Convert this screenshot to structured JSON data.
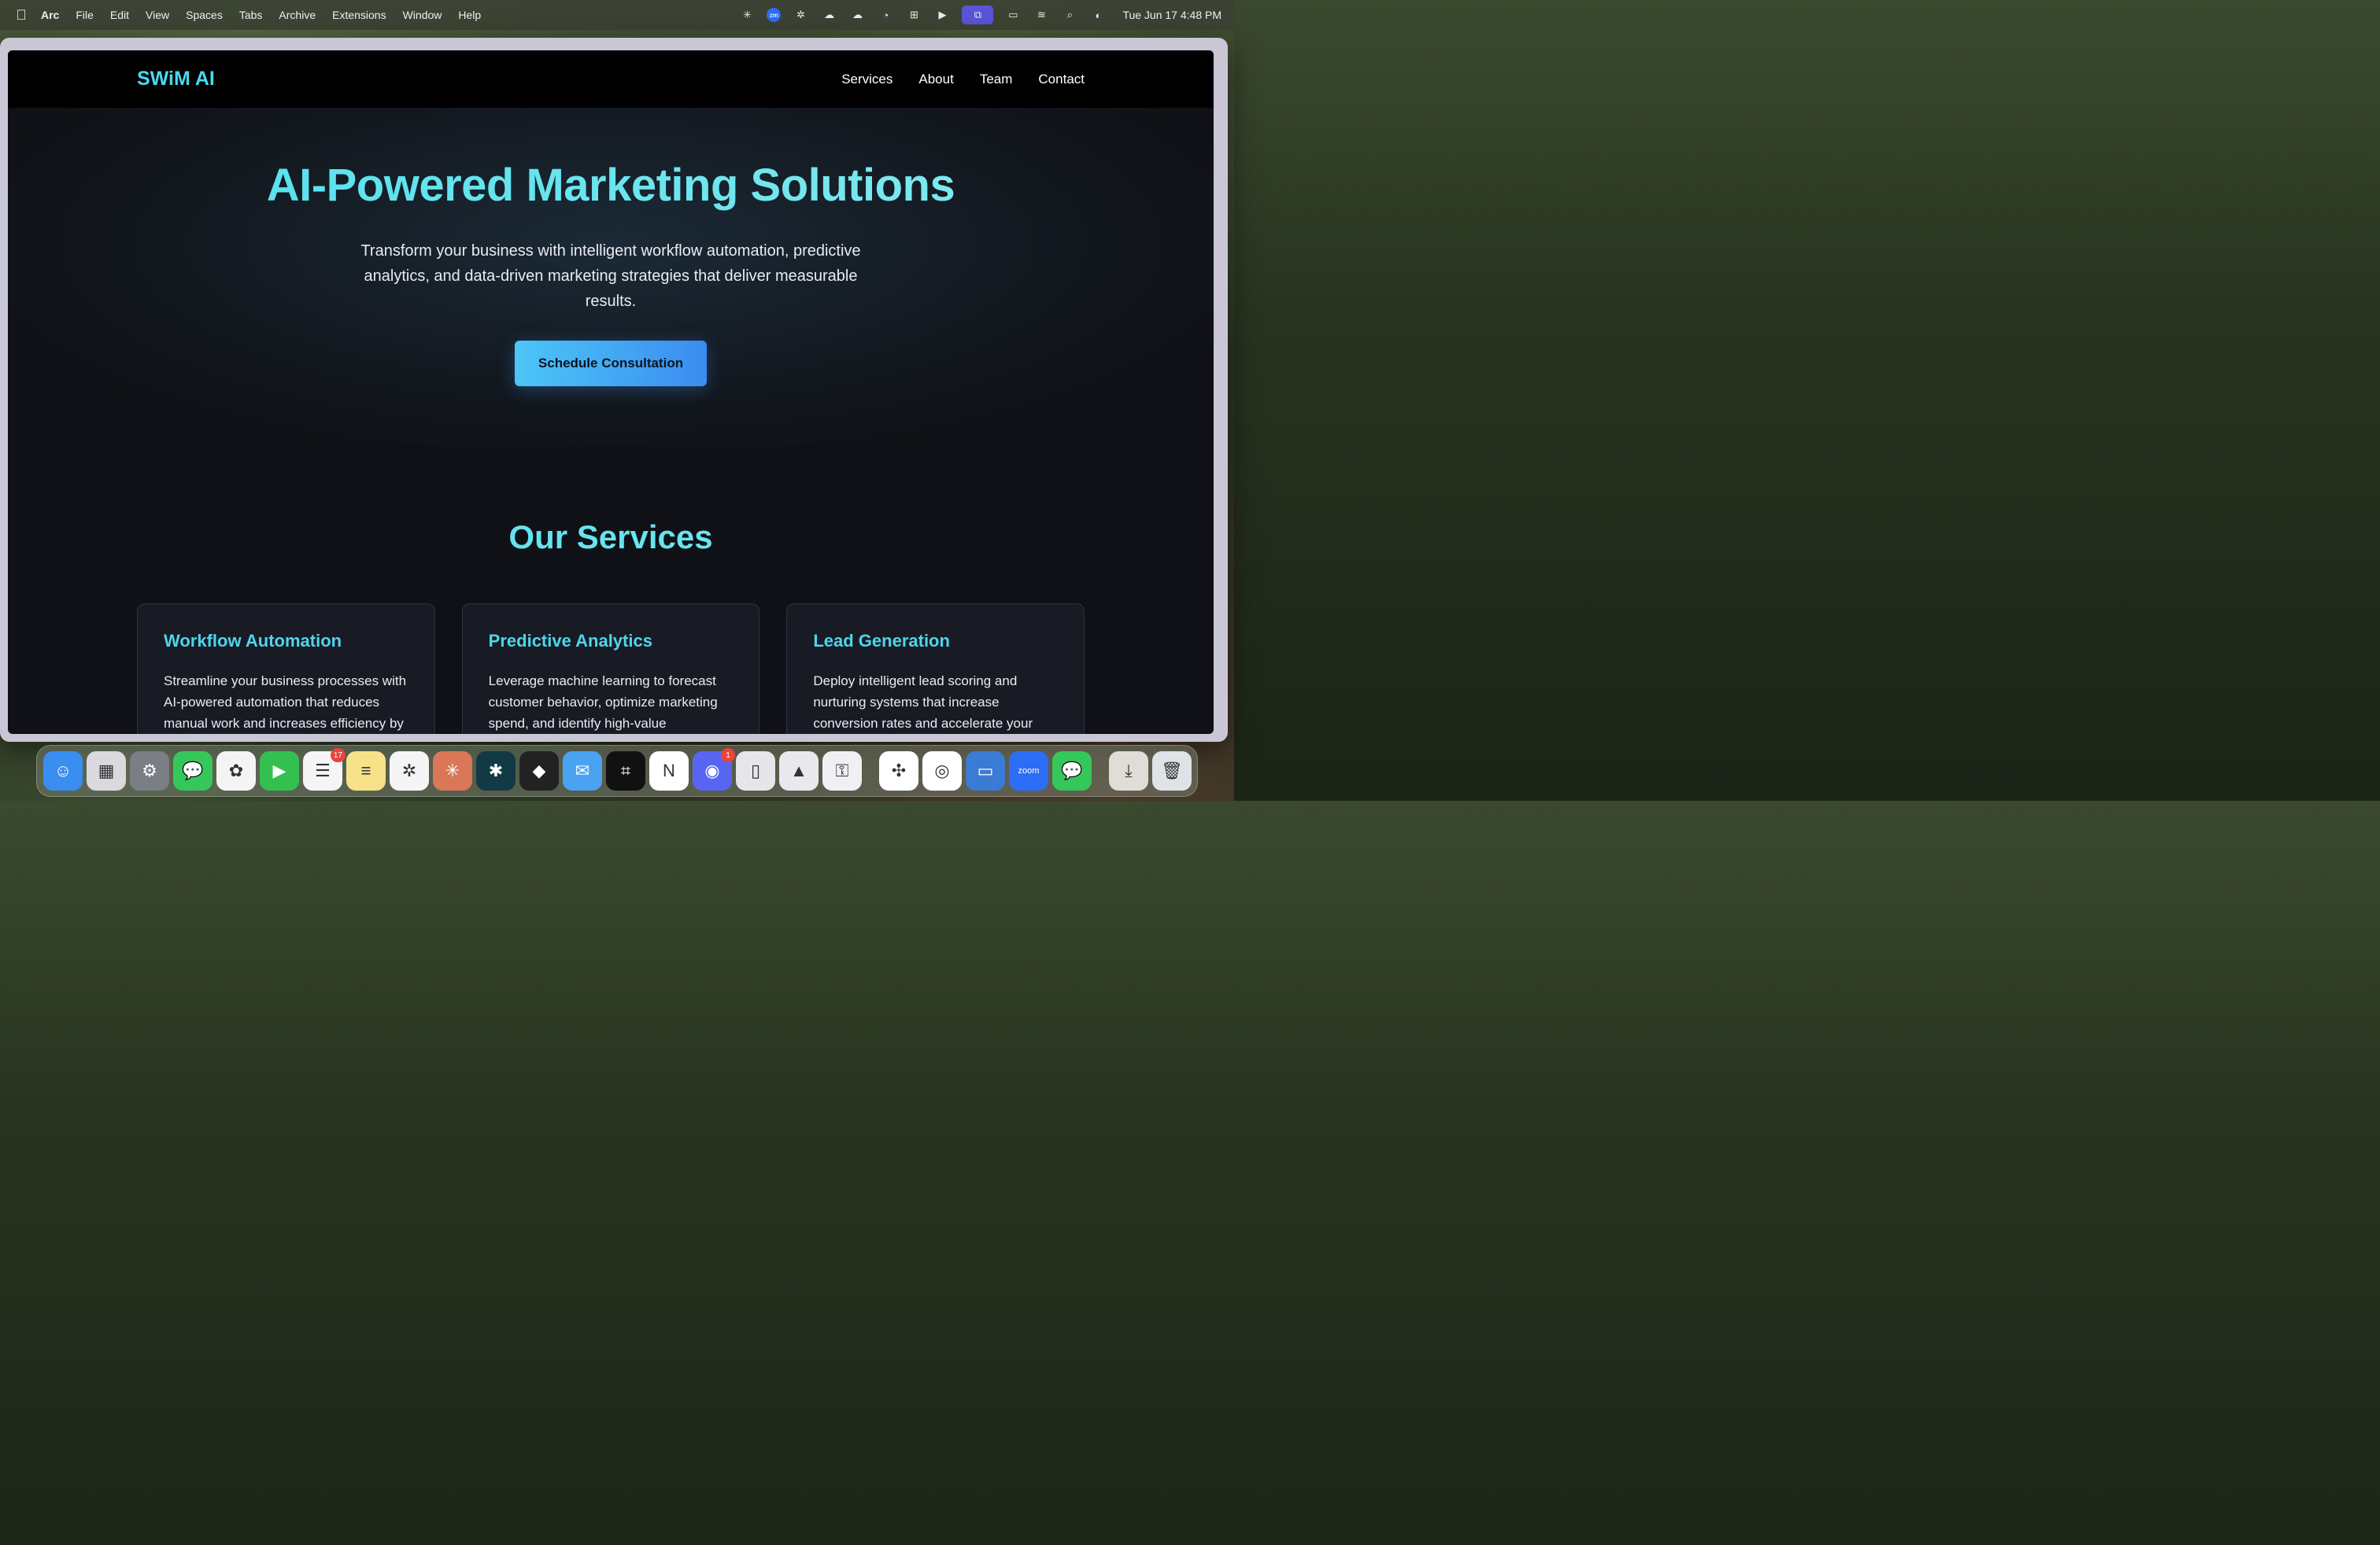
{
  "menubar": {
    "app_name": "Arc",
    "items": [
      "File",
      "Edit",
      "View",
      "Spaces",
      "Tabs",
      "Archive",
      "Extensions",
      "Window",
      "Help"
    ],
    "status_icons": [
      "perplexity-icon",
      "zoom-status-icon",
      "chatgpt-icon",
      "icloud-icon",
      "cloud-sync-icon",
      "activity-icon",
      "grid-icon",
      "play-icon",
      "screen-mirror-icon",
      "battery-icon",
      "wifi-icon",
      "search-icon",
      "control-center-icon"
    ],
    "zoom_label": "zm",
    "clock": "Tue Jun 17  4:48 PM"
  },
  "site": {
    "logo": "SWiM AI",
    "nav": [
      "Services",
      "About",
      "Team",
      "Contact"
    ],
    "hero": {
      "title": "AI-Powered Marketing Solutions",
      "subtitle": "Transform your business with intelligent workflow automation, predictive analytics, and data-driven marketing strategies that deliver measurable results.",
      "cta": "Schedule Consultation"
    },
    "services": {
      "heading": "Our Services",
      "cards": [
        {
          "title": "Workflow Automation",
          "text": "Streamline your business processes with AI-powered automation that reduces manual work and increases efficiency by"
        },
        {
          "title": "Predictive Analytics",
          "text": "Leverage machine learning to forecast customer behavior, optimize marketing spend, and identify high-value"
        },
        {
          "title": "Lead Generation",
          "text": "Deploy intelligent lead scoring and nurturing systems that increase conversion rates and accelerate your"
        }
      ]
    }
  },
  "dock": {
    "apps": [
      {
        "name": "finder-icon",
        "color": "#3a8ef0",
        "glyph": "☺"
      },
      {
        "name": "launchpad-icon",
        "color": "#d9d9de",
        "glyph": "▦"
      },
      {
        "name": "system-settings-icon",
        "color": "#7b7e85",
        "glyph": "⚙"
      },
      {
        "name": "messages-icon",
        "color": "#35c759",
        "glyph": "💬"
      },
      {
        "name": "photos-icon",
        "color": "#f4f4f4",
        "glyph": "✿"
      },
      {
        "name": "facetime-icon",
        "color": "#34c04f",
        "glyph": "▶"
      },
      {
        "name": "reminders-icon",
        "color": "#f5f5f5",
        "glyph": "☰",
        "badge": "17"
      },
      {
        "name": "notes-icon",
        "color": "#f7e28a",
        "glyph": "≡"
      },
      {
        "name": "chatgpt-app-icon",
        "color": "#f5f5f5",
        "glyph": "✲"
      },
      {
        "name": "claude-icon",
        "color": "#d97757",
        "glyph": "✳"
      },
      {
        "name": "perplexity-app-icon",
        "color": "#123a44",
        "glyph": "✱"
      },
      {
        "name": "figma-icon",
        "color": "#222",
        "glyph": "◆"
      },
      {
        "name": "airmail-icon",
        "color": "#4aa3f0",
        "glyph": "✉"
      },
      {
        "name": "screenshot-icon",
        "color": "#111",
        "glyph": "⌗"
      },
      {
        "name": "notion-icon",
        "color": "#fff",
        "glyph": "N"
      },
      {
        "name": "discord-icon",
        "color": "#5865f2",
        "glyph": "◉",
        "badge": "1"
      },
      {
        "name": "iphone-mirroring-icon",
        "color": "#e6e6ea",
        "glyph": "▯"
      },
      {
        "name": "affinity-icon",
        "color": "#e8e8ee",
        "glyph": "▲"
      },
      {
        "name": "passwords-icon",
        "color": "#f0f0f4",
        "glyph": "⚿"
      },
      {
        "name": "slack-icon",
        "color": "#fff",
        "glyph": "✣"
      },
      {
        "name": "chrome-icon",
        "color": "#fff",
        "glyph": "◎"
      },
      {
        "name": "display-icon",
        "color": "#3a7bd5",
        "glyph": "▭"
      },
      {
        "name": "zoom-app-icon",
        "color": "#2d6cf5",
        "glyph": "zoom"
      },
      {
        "name": "messages-alt-icon",
        "color": "#35c759",
        "glyph": "💬"
      },
      {
        "name": "downloads-icon",
        "color": "#e0dcd6",
        "glyph": "⤓"
      },
      {
        "name": "trash-icon",
        "color": "#dfe2e6",
        "glyph": "🗑"
      }
    ]
  }
}
